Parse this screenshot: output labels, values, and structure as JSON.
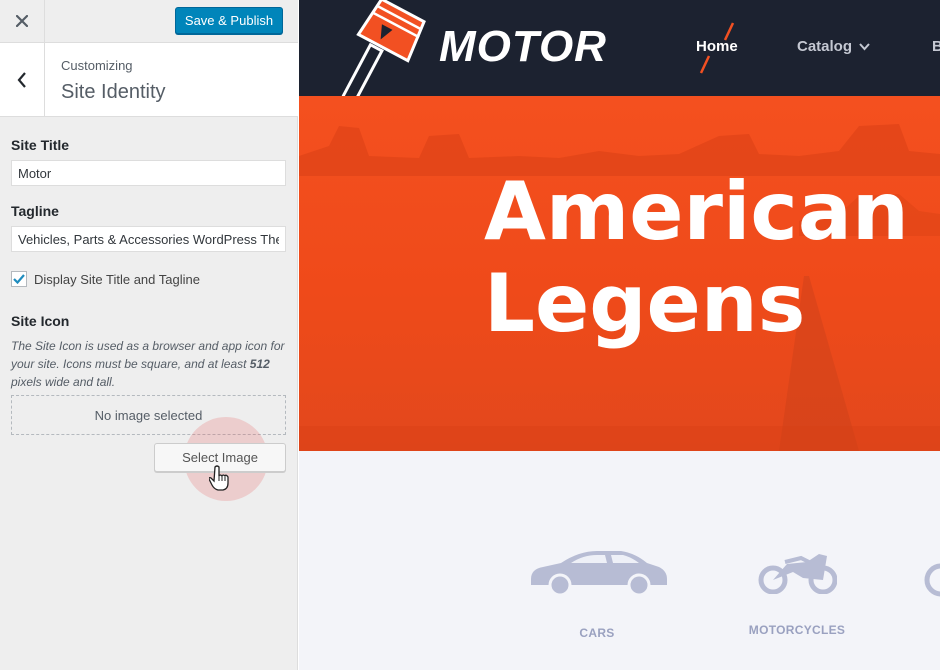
{
  "customizer": {
    "close_icon": "close-icon",
    "publish_label": "Save & Publish",
    "back_icon": "chevron-left-icon",
    "breadcrumb": "Customizing",
    "section_title": "Site Identity",
    "site_title": {
      "label": "Site Title",
      "value": "Motor"
    },
    "tagline": {
      "label": "Tagline",
      "value": "Vehicles, Parts & Accessories WordPress Theme"
    },
    "display_title_checkbox": {
      "label": "Display Site Title and Tagline",
      "checked": true
    },
    "site_icon": {
      "label": "Site Icon",
      "help_part1": "The Site Icon is used as a browser and app icon for your site. Icons must be square, and at least ",
      "help_bold": "512",
      "help_part2": " pixels wide and tall.",
      "placeholder": "No image selected",
      "button_label": "Select Image"
    }
  },
  "preview": {
    "logo_text": "MOTOR",
    "nav": {
      "home": "Home",
      "catalog": "Catalog",
      "more": "B"
    },
    "hero": {
      "line1": "American",
      "line2": "Legens"
    },
    "categories": [
      {
        "label": "CARS",
        "icon": "car-icon"
      },
      {
        "label": "MOTORCYCLES",
        "icon": "motorcycle-icon"
      }
    ],
    "colors": {
      "accent": "#f25022",
      "header_bg": "#1c2230",
      "publish_blue": "#0085ba"
    }
  }
}
